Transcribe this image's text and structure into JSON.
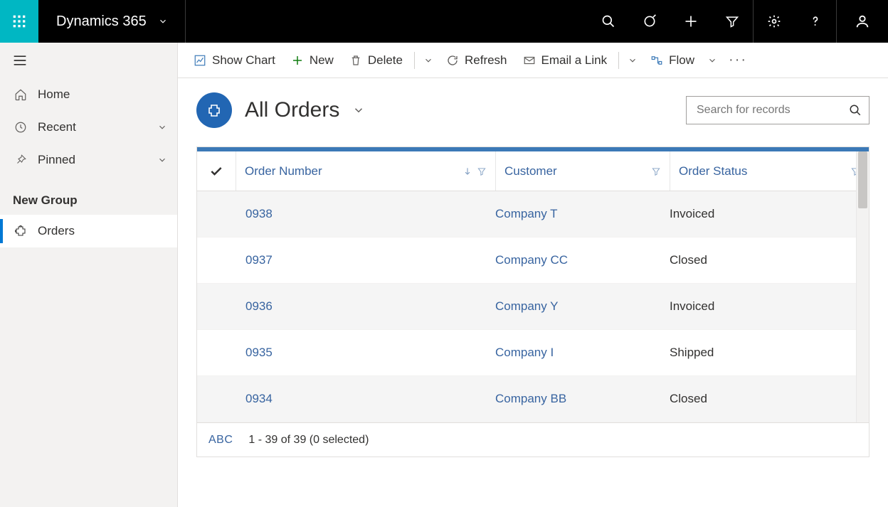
{
  "header": {
    "brand": "Dynamics 365"
  },
  "nav": {
    "home": "Home",
    "recent": "Recent",
    "pinned": "Pinned",
    "group_label": "New Group",
    "orders": "Orders"
  },
  "commands": {
    "show_chart": "Show Chart",
    "new": "New",
    "delete": "Delete",
    "refresh": "Refresh",
    "email_link": "Email a Link",
    "flow": "Flow"
  },
  "page": {
    "title": "All Orders",
    "search_placeholder": "Search for records"
  },
  "grid": {
    "columns": {
      "order_number": "Order Number",
      "customer": "Customer",
      "order_status": "Order Status"
    },
    "rows": [
      {
        "order": "0938",
        "customer": "Company T",
        "status": "Invoiced"
      },
      {
        "order": "0937",
        "customer": "Company CC",
        "status": "Closed"
      },
      {
        "order": "0936",
        "customer": "Company Y",
        "status": "Invoiced"
      },
      {
        "order": "0935",
        "customer": "Company I",
        "status": "Shipped"
      },
      {
        "order": "0934",
        "customer": "Company BB",
        "status": "Closed"
      }
    ],
    "footer": {
      "abc": "ABC",
      "paging": "1 - 39 of 39 (0 selected)"
    }
  }
}
